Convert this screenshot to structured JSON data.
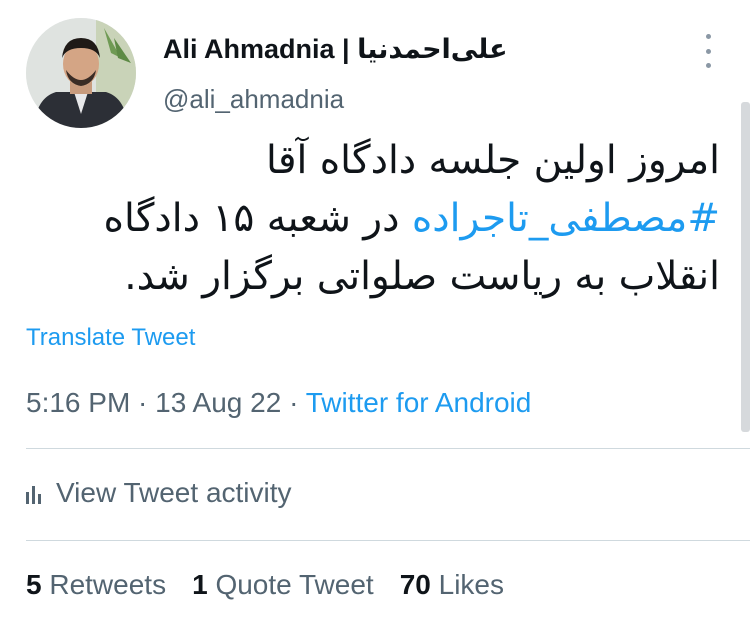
{
  "author": {
    "display_name": "Ali Ahmadnia | علی‌احمدنیا",
    "handle": "@ali_ahmadnia"
  },
  "tweet": {
    "line1": "امروز اولین جلسه دادگاه آقا",
    "hashtag": "#مصطفی_تاجراده",
    "line2_rest": " در شعبه ۱۵ دادگاه",
    "line3": "انقلاب به ریاست صلواتی برگزار شد."
  },
  "translate_label": "Translate Tweet",
  "meta": {
    "time": "5:16 PM",
    "sep1": " · ",
    "date": "13 Aug 22",
    "sep2": " · ",
    "source": "Twitter for Android"
  },
  "activity_label": "View Tweet activity",
  "stats": {
    "retweets_count": "5",
    "retweets_label": "Retweets",
    "quotes_count": "1",
    "quotes_label": "Quote Tweet",
    "likes_count": "70",
    "likes_label": "Likes"
  },
  "icons": {
    "more": "more-vertical-icon",
    "activity": "bar-chart-icon"
  }
}
